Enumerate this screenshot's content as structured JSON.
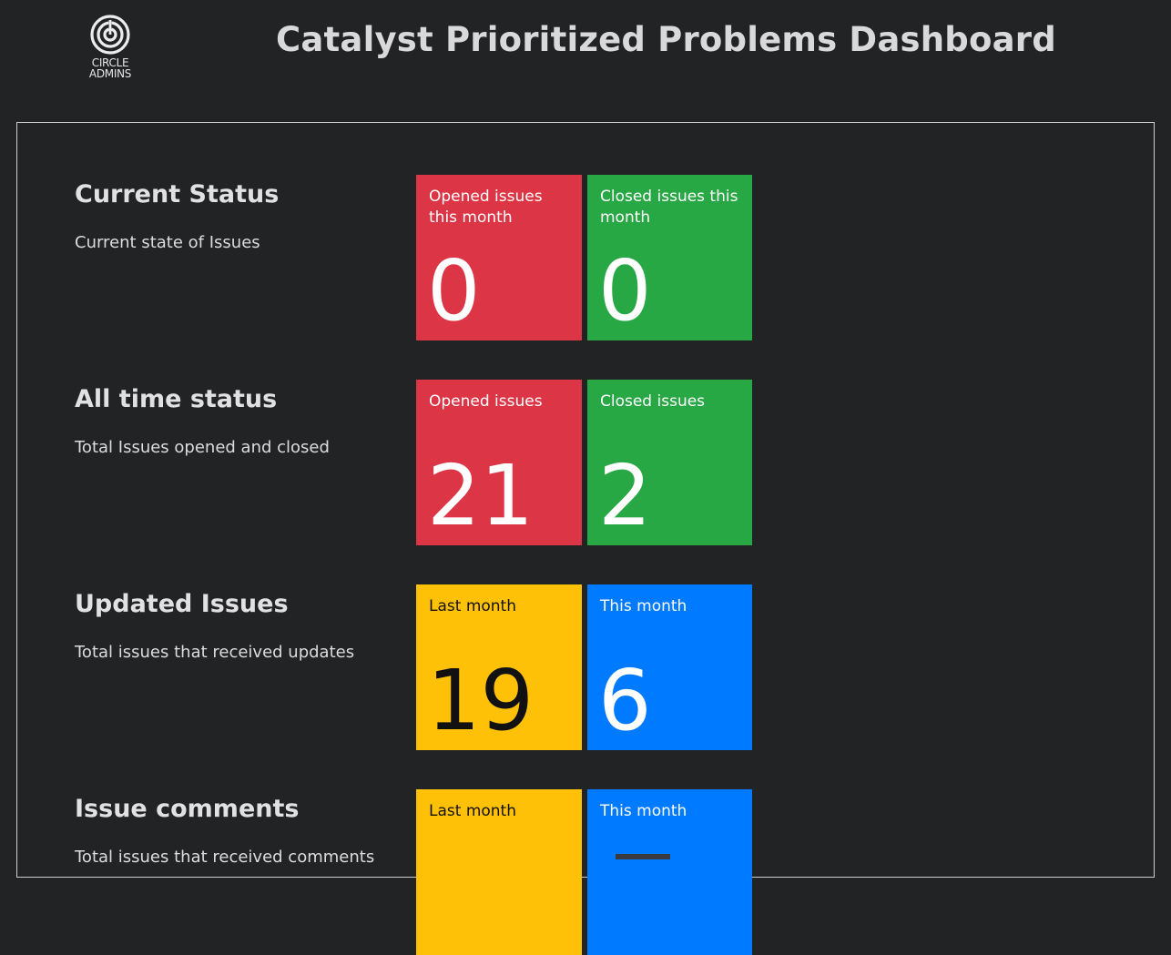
{
  "header": {
    "logo_text": "CIRCLE\nADMINS",
    "title": "Catalyst Prioritized Problems Dashboard"
  },
  "colors": {
    "background": "#222325",
    "red": "#dc3545",
    "green": "#28a745",
    "yellow": "#ffc107",
    "blue": "#007bff"
  },
  "sections": [
    {
      "heading": "Current Status",
      "description": "Current state of Issues",
      "tiles": [
        {
          "label": "Opened issues this month",
          "value": "0",
          "color": "red"
        },
        {
          "label": "Closed issues this month",
          "value": "0",
          "color": "green"
        }
      ]
    },
    {
      "heading": "All time status",
      "description": "Total Issues opened and closed",
      "tiles": [
        {
          "label": "Opened issues",
          "value": "21",
          "color": "red"
        },
        {
          "label": "Closed issues",
          "value": "2",
          "color": "green"
        }
      ]
    },
    {
      "heading": "Updated Issues",
      "description": "Total issues that received updates",
      "tiles": [
        {
          "label": "Last month",
          "value": "19",
          "color": "yellow"
        },
        {
          "label": "This month",
          "value": "6",
          "color": "blue"
        }
      ]
    },
    {
      "heading": "Issue comments",
      "description": "Total issues that received comments",
      "tiles": [
        {
          "label": "Last month",
          "value": "",
          "color": "yellow"
        },
        {
          "label": "This month",
          "value": "",
          "color": "blue"
        }
      ]
    }
  ]
}
